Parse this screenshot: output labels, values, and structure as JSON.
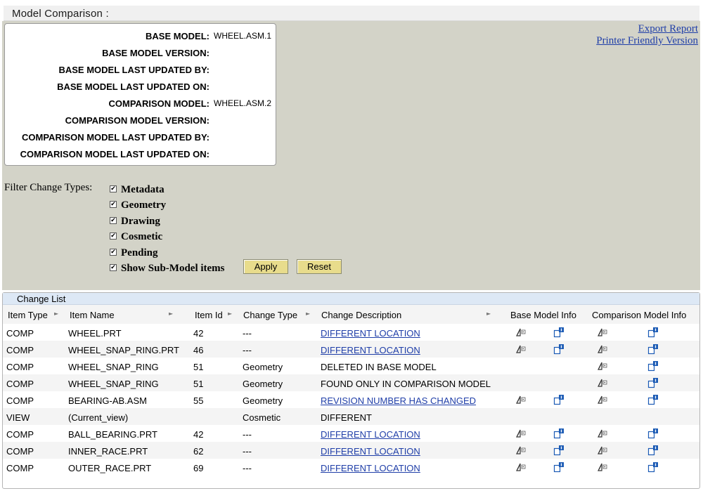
{
  "page": {
    "title": "Model Comparison :"
  },
  "model_info": [
    {
      "label": "BASE MODEL:",
      "value": "WHEEL.ASM.1"
    },
    {
      "label": "BASE MODEL VERSION:",
      "value": ""
    },
    {
      "label": "BASE MODEL LAST UPDATED BY:",
      "value": ""
    },
    {
      "label": "BASE MODEL LAST UPDATED ON:",
      "value": ""
    },
    {
      "label": "COMPARISON MODEL:",
      "value": "WHEEL.ASM.2"
    },
    {
      "label": "COMPARISON MODEL VERSION:",
      "value": ""
    },
    {
      "label": "COMPARISON MODEL LAST UPDATED BY:",
      "value": ""
    },
    {
      "label": "COMPARISON MODEL LAST UPDATED ON:",
      "value": ""
    }
  ],
  "links": {
    "export": "Export Report",
    "printer": "Printer Friendly Version"
  },
  "filter": {
    "label": "Filter Change Types:",
    "items": [
      {
        "label": "Metadata",
        "checked": true
      },
      {
        "label": "Geometry",
        "checked": true
      },
      {
        "label": "Drawing",
        "checked": true
      },
      {
        "label": "Cosmetic",
        "checked": true
      },
      {
        "label": "Pending",
        "checked": true
      },
      {
        "label": "Show Sub-Model items",
        "checked": true
      }
    ],
    "check_mark": "✔",
    "apply_label": "Apply",
    "reset_label": "Reset"
  },
  "change_list": {
    "title": "Change List",
    "columns": {
      "item_type": "Item Type",
      "item_name": "Item Name",
      "item_id": "Item Id",
      "change_type": "Change Type",
      "change_description": "Change Description",
      "base_model_info": "Base Model Info",
      "comparison_model_info": "Comparison Model Info"
    },
    "rows": [
      {
        "item_type": "COMP",
        "item_name": "WHEEL.PRT",
        "item_id": "42",
        "change_type": "---",
        "description": "DIFFERENT LOCATION",
        "description_link": true,
        "base_icons": true,
        "comp_icons": true
      },
      {
        "item_type": "COMP",
        "item_name": "WHEEL_SNAP_RING.PRT",
        "item_id": "46",
        "change_type": "---",
        "description": "DIFFERENT LOCATION",
        "description_link": true,
        "base_icons": true,
        "comp_icons": true
      },
      {
        "item_type": "COMP",
        "item_name": "WHEEL_SNAP_RING",
        "item_id": "51",
        "change_type": "Geometry",
        "description": "DELETED IN BASE MODEL",
        "description_link": false,
        "base_icons": false,
        "comp_icons": true
      },
      {
        "item_type": "COMP",
        "item_name": "WHEEL_SNAP_RING",
        "item_id": "51",
        "change_type": "Geometry",
        "description": "FOUND ONLY IN COMPARISON MODEL",
        "description_link": false,
        "base_icons": false,
        "comp_icons": true
      },
      {
        "item_type": "COMP",
        "item_name": "BEARING-AB.ASM",
        "item_id": "55",
        "change_type": "Geometry",
        "description": "REVISION NUMBER HAS CHANGED",
        "description_link": true,
        "base_icons": true,
        "comp_icons": true
      },
      {
        "item_type": "VIEW",
        "item_name": "(Current_view)",
        "item_id": "",
        "change_type": "Cosmetic",
        "description": "DIFFERENT",
        "description_link": false,
        "base_icons": false,
        "comp_icons": false
      },
      {
        "item_type": "COMP",
        "item_name": "BALL_BEARING.PRT",
        "item_id": "42",
        "change_type": "---",
        "description": "DIFFERENT LOCATION",
        "description_link": true,
        "base_icons": true,
        "comp_icons": true
      },
      {
        "item_type": "COMP",
        "item_name": "INNER_RACE.PRT",
        "item_id": "62",
        "change_type": "---",
        "description": "DIFFERENT LOCATION",
        "description_link": true,
        "base_icons": true,
        "comp_icons": true
      },
      {
        "item_type": "COMP",
        "item_name": "OUTER_RACE.PRT",
        "item_id": "69",
        "change_type": "---",
        "description": "DIFFERENT LOCATION",
        "description_link": true,
        "base_icons": true,
        "comp_icons": true
      }
    ]
  },
  "colors": {
    "panel_bg": "#d3d3c8",
    "link": "#1f3ea8",
    "button": "#e8dc8c",
    "list_title_bg": "#dde8f5"
  },
  "icons": {
    "sort": "sort-arrow-icon",
    "model_view": "model-view-icon",
    "model_info": "model-info-icon"
  }
}
